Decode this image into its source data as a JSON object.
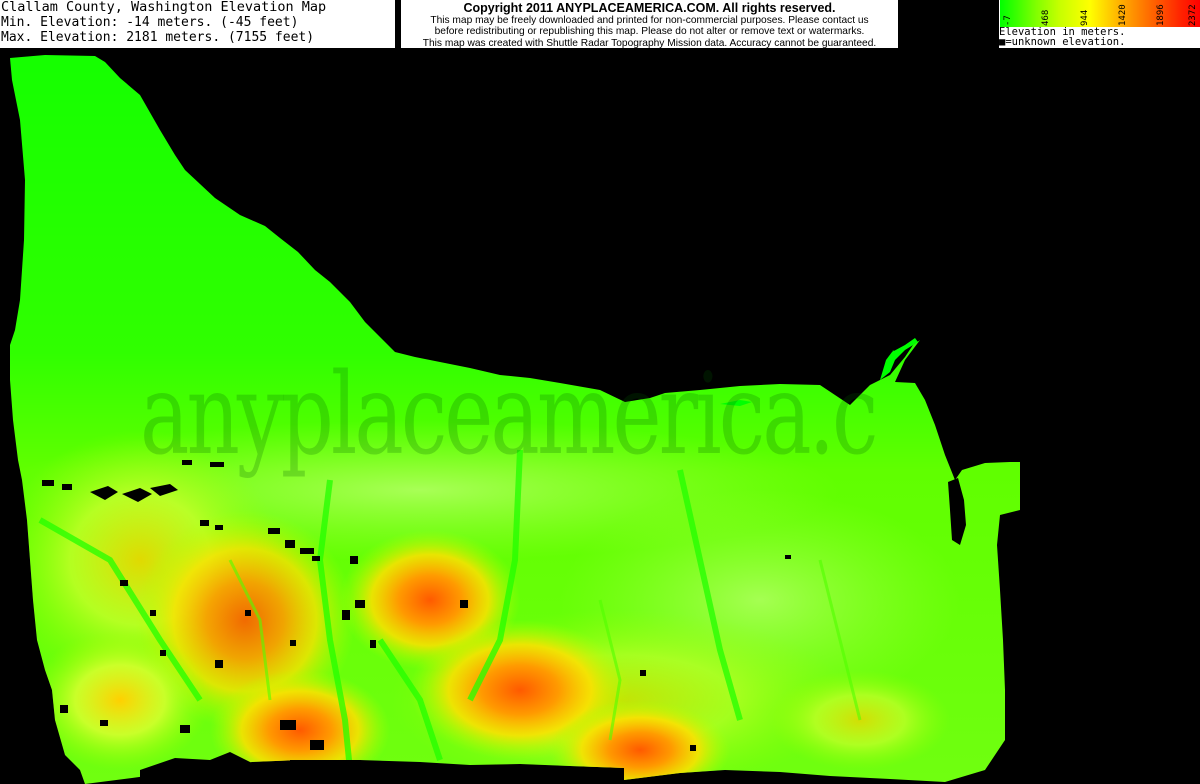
{
  "header": {
    "title": "Clallam County, Washington Elevation Map",
    "min_elevation": "Min. Elevation: -14 meters. (-45 feet)",
    "max_elevation": "Max. Elevation: 2181 meters. (7155 feet)"
  },
  "notice": {
    "copyright": "Copyright 2011 ANYPLACEAMERICA.COM.  All rights reserved.",
    "line1": "This map may be freely downloaded and printed for non-commercial purposes.  Please contact us",
    "line2": "before redistributing or republishing this map.  Please do not alter or remove text or watermarks.",
    "line3": "This map was created with Shuttle Radar Topography Mission data.  Accuracy cannot be guaranteed."
  },
  "legend": {
    "ticks": [
      "-7",
      "468",
      "944",
      "1420",
      "1896",
      "2372"
    ],
    "caption": "Elevation in meters.",
    "unknown": "■=unknown elevation."
  },
  "watermark": "anyplaceamerica.c",
  "colors": {
    "low": "#00ff00",
    "mid_low": "#80ff00",
    "mid": "#ffff00",
    "high": "#ff8000",
    "peak": "#ff0000",
    "unknown": "#000000"
  }
}
